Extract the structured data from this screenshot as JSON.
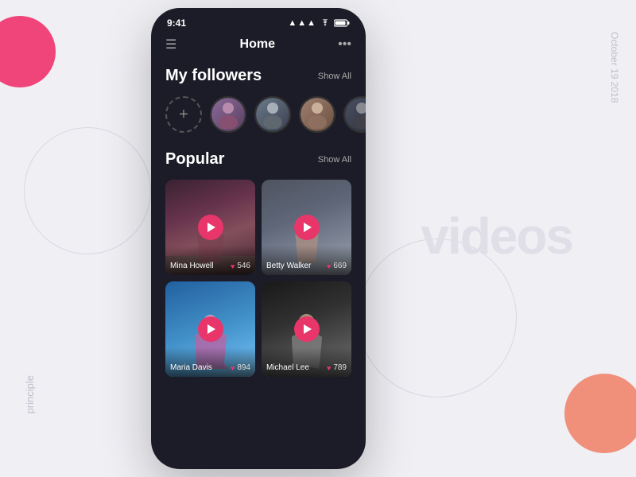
{
  "background": {
    "text_videos": "videos",
    "text_principle": "principle",
    "text_date": "October 19   2018"
  },
  "phone": {
    "status_bar": {
      "time": "9:41",
      "signal": "▲▲▲",
      "wifi": "wifi",
      "battery": "battery"
    },
    "nav": {
      "title": "Home"
    },
    "followers_section": {
      "title": "My followers",
      "show_all": "Show All",
      "avatars": [
        {
          "name": "follower-1"
        },
        {
          "name": "follower-2"
        },
        {
          "name": "follower-3"
        },
        {
          "name": "follower-4"
        }
      ]
    },
    "popular_section": {
      "title": "Popular",
      "show_all": "Show All",
      "videos": [
        {
          "id": 1,
          "name": "Mina Howell",
          "likes": "546",
          "thumb_class": "thumb-1",
          "shape_class": "shape-woman1"
        },
        {
          "id": 2,
          "name": "Betty Walker",
          "likes": "669",
          "thumb_class": "thumb-2",
          "shape_class": "shape-woman2"
        },
        {
          "id": 3,
          "name": "Maria Davis",
          "likes": "894",
          "thumb_class": "thumb-3",
          "shape_class": "shape-girl"
        },
        {
          "id": 4,
          "name": "Michael Lee",
          "likes": "789",
          "thumb_class": "thumb-4",
          "shape_class": "shape-man"
        }
      ]
    }
  }
}
